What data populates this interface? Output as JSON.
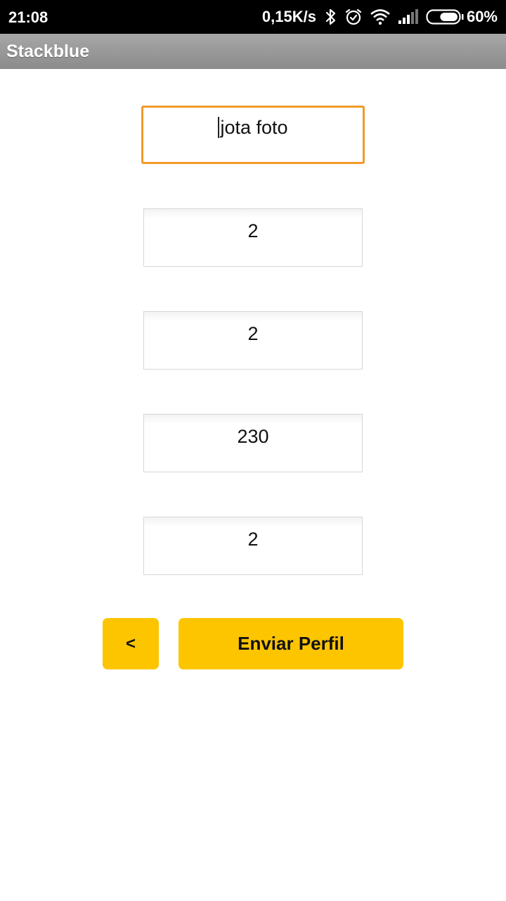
{
  "status_bar": {
    "time": "21:08",
    "net_speed": "0,15K/s",
    "battery": "60%",
    "icons": [
      "bluetooth-icon",
      "alarm-icon",
      "wifi-icon",
      "signal-icon",
      "battery-icon"
    ],
    "battery_level": 0.6
  },
  "app_bar": {
    "title": "Stackblue"
  },
  "form": {
    "fields": [
      {
        "value": "jota foto",
        "focused": true
      },
      {
        "value": "2"
      },
      {
        "value": "2"
      },
      {
        "value": "230"
      },
      {
        "value": "2"
      }
    ]
  },
  "buttons": {
    "back_label": "<",
    "send_label": "Enviar Perfil"
  },
  "colors": {
    "accent": "#fdc500",
    "focus_border": "#f09a2a",
    "app_bar": "#999999",
    "status_bar": "#000000"
  }
}
